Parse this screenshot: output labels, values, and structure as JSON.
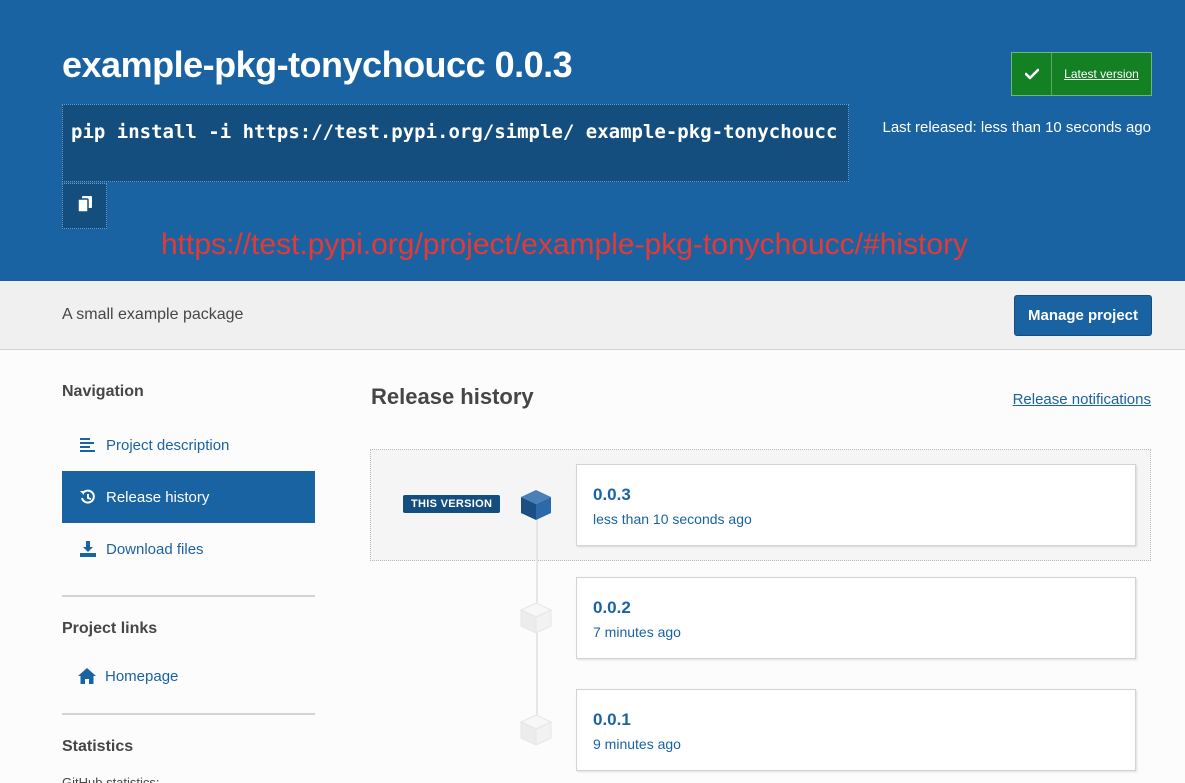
{
  "header": {
    "title": "example-pkg-tonychoucc 0.0.3",
    "pip_command": "pip install -i https://test.pypi.org/simple/ example-pkg-tonychoucc",
    "latest_version_label": "Latest version",
    "last_released": "Last released: less than 10 seconds ago",
    "annotation_url": "https://test.pypi.org/project/example-pkg-tonychoucc/#history"
  },
  "summary": {
    "text": "A small example package",
    "manage_button": "Manage project"
  },
  "sidebar": {
    "navigation_heading": "Navigation",
    "items": [
      {
        "label": "Project description",
        "icon": "align-left-icon"
      },
      {
        "label": "Release history",
        "icon": "history-icon",
        "active": true
      },
      {
        "label": "Download files",
        "icon": "download-icon"
      }
    ],
    "project_links_heading": "Project links",
    "links": [
      {
        "label": "Homepage",
        "icon": "home-icon"
      }
    ],
    "statistics_heading": "Statistics",
    "statistics_sub": "GitHub statistics:"
  },
  "main": {
    "title": "Release history",
    "notifications_link": "Release notifications",
    "this_version_badge": "THIS VERSION",
    "releases": [
      {
        "version": "0.0.3",
        "date": "less than 10 seconds ago",
        "current": true
      },
      {
        "version": "0.0.2",
        "date": "7 minutes ago"
      },
      {
        "version": "0.0.1",
        "date": "9 minutes ago"
      }
    ]
  },
  "colors": {
    "brand_blue": "#1a63a2",
    "dark_blue": "#144e7f",
    "success_green": "#148024",
    "annotation_red": "#e53935"
  }
}
